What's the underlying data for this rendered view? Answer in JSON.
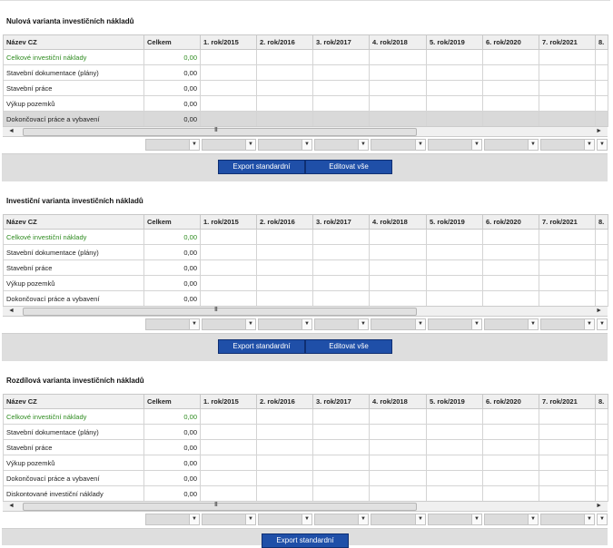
{
  "columns": [
    "Název CZ",
    "Celkem",
    "1. rok/2015",
    "2. rok/2016",
    "3. rok/2017",
    "4. rok/2018",
    "5. rok/2019",
    "6. rok/2020",
    "7. rok/2021",
    "8."
  ],
  "sections": [
    {
      "title": "Nulová varianta investičních nákladů",
      "rows": [
        {
          "name": "Celkové investiční náklady",
          "value": "0,00"
        },
        {
          "name": "Stavební dokumentace (plány)",
          "value": "0,00"
        },
        {
          "name": "Stavební práce",
          "value": "0,00"
        },
        {
          "name": "Výkup pozemků",
          "value": "0,00"
        },
        {
          "name": "Dokončovací práce a vybavení",
          "value": "0,00"
        }
      ],
      "buttons": [
        "Export standardní",
        "Editovat vše"
      ]
    },
    {
      "title": "Investiční varianta investičních nákladů",
      "rows": [
        {
          "name": "Celkové investiční náklady",
          "value": "0,00"
        },
        {
          "name": "Stavební dokumentace (plány)",
          "value": "0,00"
        },
        {
          "name": "Stavební práce",
          "value": "0,00"
        },
        {
          "name": "Výkup pozemků",
          "value": "0,00"
        },
        {
          "name": "Dokončovací práce a vybavení",
          "value": "0,00"
        }
      ],
      "buttons": [
        "Export standardní",
        "Editovat vše"
      ]
    },
    {
      "title": "Rozdílová varianta investičních nákladů",
      "rows": [
        {
          "name": "Celkové investiční náklady",
          "value": "0,00"
        },
        {
          "name": "Stavební dokumentace (plány)",
          "value": "0,00"
        },
        {
          "name": "Stavební práce",
          "value": "0,00"
        },
        {
          "name": "Výkup pozemků",
          "value": "0,00"
        },
        {
          "name": "Dokončovací práce a vybavení",
          "value": "0,00"
        },
        {
          "name": "Diskontované investiční náklady",
          "value": "0,00"
        }
      ],
      "buttons": [
        "Export standardní"
      ]
    }
  ],
  "scroll": {
    "left_arrow": "◄",
    "right_arrow": "►",
    "grip": "III"
  },
  "filter_arrow": "▼",
  "colors": {
    "accent": "#1f4fa8",
    "highlight_text": "#2e8b1f"
  }
}
